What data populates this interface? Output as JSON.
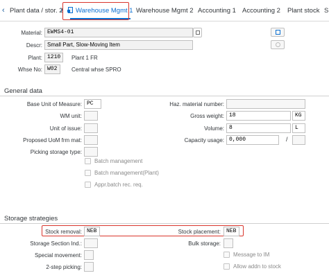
{
  "tabs": [
    {
      "label": "Plant data / stor. 2"
    },
    {
      "label": "Warehouse Mgmt 1"
    },
    {
      "label": "Warehouse Mgmt 2"
    },
    {
      "label": "Accounting 1"
    },
    {
      "label": "Accounting 2"
    },
    {
      "label": "Plant stock"
    },
    {
      "label": "S"
    }
  ],
  "nav": {
    "prev": "‹",
    "next": "›"
  },
  "header": {
    "material_label": "Material:",
    "material_value": "EWMS4-01",
    "descr_label": "Descr:",
    "descr_value": "Small Part, Slow-Moving Item",
    "plant_label": "Plant:",
    "plant_value": "1210",
    "plant_text": "Plant 1 FR",
    "whse_label": "Whse No:",
    "whse_value": "W02",
    "whse_text": "Central whse SPRO"
  },
  "general": {
    "title": "General data",
    "base_uom_label": "Base Unit of Measure:",
    "base_uom_value": "PC",
    "wm_unit_label": "WM unit:",
    "unit_issue_label": "Unit of issue:",
    "proposed_uom_label": "Proposed UoM frm mat:",
    "picking_storage_label": "Picking storage type:",
    "haz_label": "Haz. material number:",
    "gross_weight_label": "Gross weight:",
    "gross_weight_value": "18",
    "gross_weight_unit": "KG",
    "volume_label": "Volume:",
    "volume_value": "8",
    "volume_unit": "L",
    "capacity_label": "Capacity usage:",
    "capacity_value": "0,000",
    "capacity_sep": "/",
    "batch_mgmt": "Batch management",
    "batch_mgmt_plant": "Batch management(Plant)",
    "appr_batch": "Appr.batch rec. req."
  },
  "storage": {
    "title": "Storage strategies",
    "stock_removal_label": "Stock removal:",
    "stock_removal_value": "NEB",
    "stock_placement_label": "Stock placement:",
    "stock_placement_value": "NEB",
    "storage_section_label": "Storage Section Ind.:",
    "bulk_storage_label": "Bulk storage:",
    "special_movement_label": "Special movement:",
    "message_im": "Message to IM",
    "two_step_label": "2-step picking:",
    "allow_addn": "Allow addn to stock"
  }
}
